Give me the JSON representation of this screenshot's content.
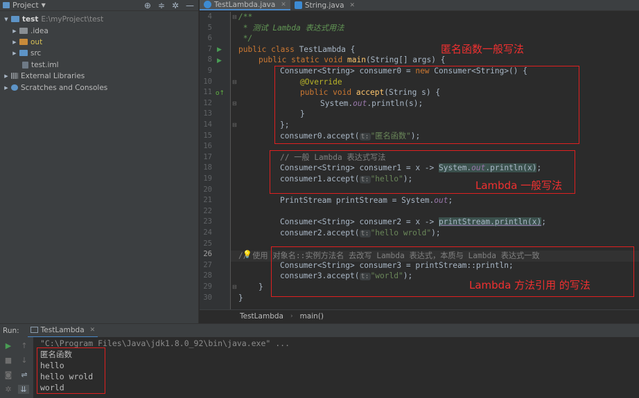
{
  "project_panel": {
    "title": "Project",
    "tree": [
      {
        "label": "test",
        "path": "E:\\myProject\\test"
      },
      {
        "label": ".idea"
      },
      {
        "label": "out"
      },
      {
        "label": "src"
      },
      {
        "label": "test.iml"
      },
      {
        "label": "External Libraries"
      },
      {
        "label": "Scratches and Consoles"
      }
    ]
  },
  "tabs": [
    {
      "label": "TestLambda.java",
      "active": true
    },
    {
      "label": "String.java",
      "active": false
    }
  ],
  "editor": {
    "line_numbers": [
      "4",
      "5",
      "6",
      "7",
      "8",
      "9",
      "10",
      "11",
      "12",
      "13",
      "14",
      "15",
      "16",
      "17",
      "18",
      "19",
      "20",
      "21",
      "22",
      "23",
      "24",
      "25",
      "26",
      "27",
      "28",
      "29",
      "30"
    ],
    "current_line": "26",
    "code": {
      "l4": "/**",
      "l5": " * 测试 Lambda 表达式用法",
      "l6": " */",
      "l7_kw": "public class ",
      "l7_name": "TestLambda {",
      "l8_kw": "public static void ",
      "l8_fn": "main",
      "l8_rest": "(String[] args) {",
      "l9_a": "Consumer<String> consumer0 = ",
      "l9_kw": "new ",
      "l9_b": "Consumer<String>() {",
      "l10": "@Override",
      "l11_kw": "public void ",
      "l11_fn": "accept",
      "l11_rest": "(String s) {",
      "l12_a": "System.",
      "l12_it": "out",
      "l12_b": ".println(s);",
      "l13": "}",
      "l14": "};",
      "l15_a": "consumer0.accept(",
      "l15_hint": "t:",
      "l15_str": "\"匿名函数\"",
      "l15_b": ");",
      "l17": "// 一般 Lambda 表达式写法",
      "l18_a": "Consumer<String> consumer1 = x -> ",
      "l18_h1": "System.",
      "l18_it": "out",
      "l18_h2": ".println(x)",
      "l18_b": ";",
      "l19_a": "consumer1.accept(",
      "l19_hint": "t:",
      "l19_str": "\"hello\"",
      "l19_b": ");",
      "l21_a": "PrintStream printStream = System.",
      "l21_it": "out",
      "l21_b": ";",
      "l23_a": "Consumer<String> consumer2 = x -> ",
      "l23_h": "printStream.println(x)",
      "l23_b": ";",
      "l24_a": "consumer2.accept(",
      "l24_hint": "t:",
      "l24_str": "\"hello wrold\"",
      "l24_b": ");",
      "l26": "// 使用 对象名::实例方法名 去改写 Lambda 表达式，本质与 Lambda 表达式一致",
      "l27": "Consumer<String> consumer3 = printStream::println;",
      "l28_a": "consumer3.accept(",
      "l28_hint": "t:",
      "l28_str": "\"world\"",
      "l28_b": ");",
      "l29": "}",
      "l30": "}"
    },
    "annotations": {
      "anonymous": "匿名函数一般写法",
      "lambda": "Lambda 一般写法",
      "method_ref": "Lambda 方法引用 的写法"
    },
    "annotation_color": "#e02020"
  },
  "breadcrumb": [
    "TestLambda",
    "main()"
  ],
  "run_panel": {
    "label": "Run:",
    "tab": "TestLambda",
    "output": [
      "\"C:\\Program Files\\Java\\jdk1.8.0_92\\bin\\java.exe\" ...",
      "匿名函数",
      "hello",
      "hello wrold",
      "world"
    ]
  }
}
